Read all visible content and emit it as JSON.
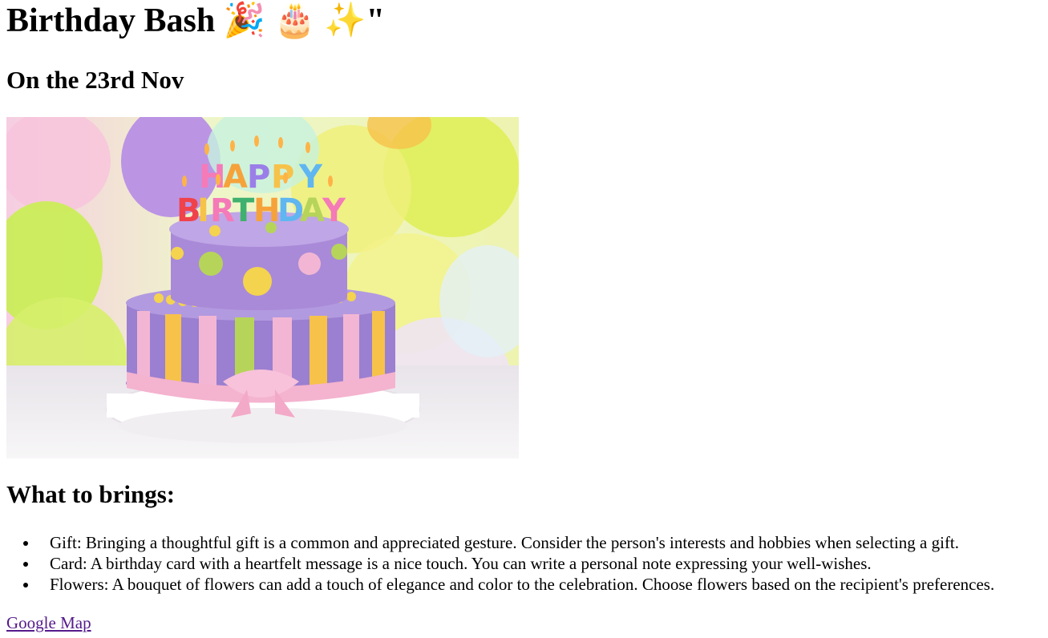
{
  "page": {
    "title": "Birthday Bash 🎉 🎂 ✨\"",
    "date_heading": "On the 23rd Nov",
    "image": {
      "alt": "birthday cake",
      "caption_letters_top": "HAPPY",
      "caption_letters_bottom": "BIRTHDAY"
    },
    "bring_heading": "What to brings:",
    "items": [
      "Gift: Bringing a thoughtful gift is a common and appreciated gesture. Consider the person's interests and hobbies when selecting a gift.",
      "Card: A birthday card with a heartfelt message is a nice touch. You can write a personal note expressing your well-wishes.",
      "Flowers: A bouquet of flowers can add a touch of elegance and color to the celebration. Choose flowers based on the recipient's preferences."
    ],
    "link_label": "Google Map"
  },
  "colors": {
    "link_visited": "#551a8b",
    "cake_purple": "#9b7fd0",
    "cake_pink": "#f2b6d4",
    "cake_yellow": "#f4d34f",
    "cake_green": "#b6d45a"
  }
}
